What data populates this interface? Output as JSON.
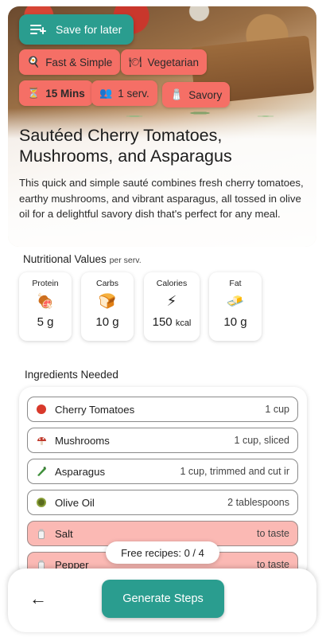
{
  "hero": {
    "save_label": "Save for later",
    "icon": "playlist-add-icon",
    "chips": [
      {
        "icon": "pan-icon",
        "glyph": "🍳",
        "label": "Fast & Simple",
        "bold": false
      },
      {
        "icon": "plate-icon",
        "glyph": "🍽",
        "label": "Vegetarian",
        "bold": false
      },
      {
        "icon": "hourglass-icon",
        "glyph": "⏳",
        "label": "15 Mins",
        "bold": true
      },
      {
        "icon": "people-icon",
        "glyph": "👥",
        "label": "1 serv.",
        "bold": false
      },
      {
        "icon": "salt-shaker-icon",
        "glyph": "🧂",
        "label": "Savory",
        "bold": false
      }
    ],
    "title": "Sautéed Cherry Tomatoes, Mushrooms, and Asparagus",
    "description": "This quick and simple sauté combines fresh cherry tomatoes, earthy mushrooms, and vibrant asparagus, all tossed in olive oil for a delightful savory dish that's perfect for any meal."
  },
  "nutrition": {
    "heading": "Nutritional Values",
    "per": "per serv.",
    "items": [
      {
        "label": "Protein",
        "icon": "meat-icon",
        "glyph": "🍖",
        "value": "5 g",
        "unit": ""
      },
      {
        "label": "Carbs",
        "icon": "bread-icon",
        "glyph": "🍞",
        "value": "10 g",
        "unit": ""
      },
      {
        "label": "Calories",
        "icon": "lightning-icon",
        "glyph": "⚡",
        "value": "150",
        "unit": "kcal"
      },
      {
        "label": "Fat",
        "icon": "butter-icon",
        "glyph": "🧈",
        "value": "10 g",
        "unit": ""
      }
    ]
  },
  "ingredients": {
    "heading": "Ingredients Needed",
    "items": [
      {
        "name": "Cherry Tomatoes",
        "qty": "1 cup",
        "icon": "tomato-icon",
        "color": "#d8392b",
        "warn": false
      },
      {
        "name": "Mushrooms",
        "qty": "1 cup, sliced",
        "icon": "mushroom-icon",
        "color": "#c0392b",
        "warn": false
      },
      {
        "name": "Asparagus",
        "qty": "1 cup, trimmed and cut ir",
        "icon": "asparagus-icon",
        "color": "#3f8f3a",
        "warn": false
      },
      {
        "name": "Olive Oil",
        "qty": "2 tablespoons",
        "icon": "olive-icon",
        "color": "#5a6b1e",
        "warn": false
      },
      {
        "name": "Salt",
        "qty": "to taste",
        "icon": "salt-icon",
        "color": "#c9c9c9",
        "warn": true
      },
      {
        "name": "Pepper",
        "qty": "to taste",
        "icon": "pepper-icon",
        "color": "#c9c9c9",
        "warn": true
      }
    ]
  },
  "free_recipes": "Free recipes: 0 / 4",
  "bottom": {
    "back_icon": "back-arrow-icon",
    "back_glyph": "←",
    "generate_label": "Generate Steps"
  },
  "colors": {
    "accent": "#2a9d8f",
    "chip": "#f56f66",
    "warn_row": "#fbb9b4"
  }
}
